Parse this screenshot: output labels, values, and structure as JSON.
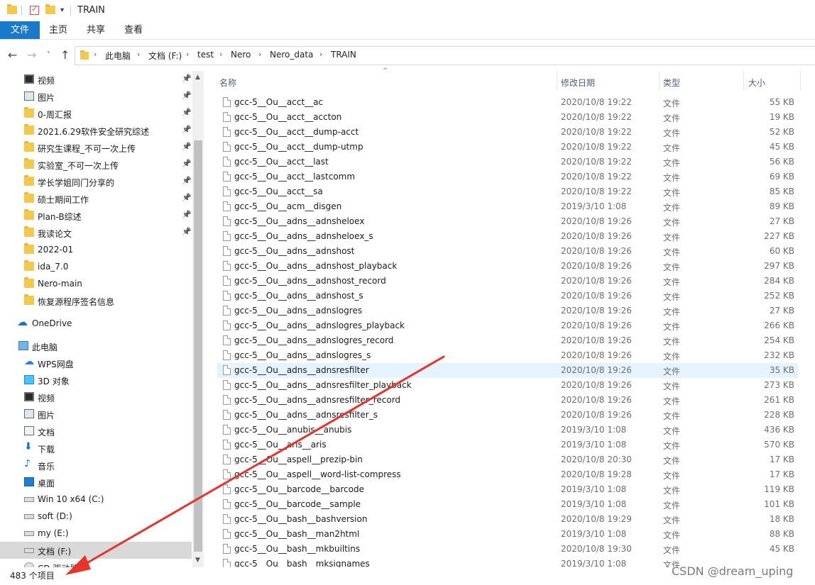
{
  "window": {
    "title": "TRAIN"
  },
  "ribbon": {
    "tabs": [
      "文件",
      "主页",
      "共享",
      "查看"
    ]
  },
  "address": {
    "crumbs": [
      "此电脑",
      "文档 (F:)",
      "test",
      "Nero",
      "Nero_data",
      "TRAIN"
    ]
  },
  "nav": {
    "quick": [
      {
        "label": "视频",
        "icon": "video-icon",
        "pinned": true
      },
      {
        "label": "图片",
        "icon": "pictures-icon",
        "pinned": true
      },
      {
        "label": "0-周汇报",
        "icon": "folder-icon",
        "pinned": true
      },
      {
        "label": "2021.6.29软件安全研究综述",
        "icon": "folder-icon",
        "pinned": true
      },
      {
        "label": "研究生课程_不可一次上传",
        "icon": "folder-icon",
        "pinned": true
      },
      {
        "label": "实验室_不可一次上传",
        "icon": "folder-icon",
        "pinned": true
      },
      {
        "label": "学长学姐同门分享的",
        "icon": "folder-icon",
        "pinned": true
      },
      {
        "label": "硕士期间工作",
        "icon": "folder-icon",
        "pinned": true
      },
      {
        "label": "Plan-B综述",
        "icon": "folder-icon",
        "pinned": true
      },
      {
        "label": "我读论文",
        "icon": "folder-icon",
        "pinned": true
      },
      {
        "label": "2022-01",
        "icon": "folder-icon",
        "pinned": false
      },
      {
        "label": "ida_7.0",
        "icon": "folder-icon",
        "pinned": false
      },
      {
        "label": "Nero-main",
        "icon": "folder-icon",
        "pinned": false
      },
      {
        "label": "恢复源程序签名信息",
        "icon": "folder-icon",
        "pinned": false
      }
    ],
    "onedrive": "OneDrive",
    "thispc": "此电脑",
    "pc_items": [
      {
        "label": "WPS网盘",
        "icon": "wps-cloud-icon"
      },
      {
        "label": "3D 对象",
        "icon": "3d-objects-icon"
      },
      {
        "label": "视频",
        "icon": "video-icon"
      },
      {
        "label": "图片",
        "icon": "pictures-icon"
      },
      {
        "label": "文档",
        "icon": "documents-icon"
      },
      {
        "label": "下载",
        "icon": "downloads-icon"
      },
      {
        "label": "音乐",
        "icon": "music-icon"
      },
      {
        "label": "桌面",
        "icon": "desktop-icon"
      },
      {
        "label": "Win 10 x64 (C:)",
        "icon": "drive-icon"
      },
      {
        "label": "soft (D:)",
        "icon": "drive-icon"
      },
      {
        "label": "my (E:)",
        "icon": "drive-icon"
      },
      {
        "label": "文档 (F:)",
        "icon": "drive-icon",
        "selected": true
      },
      {
        "label": "CD 驱动器 (",
        "icon": "cd-drive-icon"
      }
    ]
  },
  "columns": {
    "name": "名称",
    "date": "修改日期",
    "type": "类型",
    "size": "大小"
  },
  "files": [
    {
      "name": "gcc-5__Ou__acct__ac",
      "date": "2020/10/8 19:22",
      "type": "文件",
      "size": "55 KB"
    },
    {
      "name": "gcc-5__Ou__acct__accton",
      "date": "2020/10/8 19:22",
      "type": "文件",
      "size": "19 KB"
    },
    {
      "name": "gcc-5__Ou__acct__dump-acct",
      "date": "2020/10/8 19:22",
      "type": "文件",
      "size": "52 KB"
    },
    {
      "name": "gcc-5__Ou__acct__dump-utmp",
      "date": "2020/10/8 19:22",
      "type": "文件",
      "size": "45 KB"
    },
    {
      "name": "gcc-5__Ou__acct__last",
      "date": "2020/10/8 19:22",
      "type": "文件",
      "size": "56 KB"
    },
    {
      "name": "gcc-5__Ou__acct__lastcomm",
      "date": "2020/10/8 19:22",
      "type": "文件",
      "size": "69 KB"
    },
    {
      "name": "gcc-5__Ou__acct__sa",
      "date": "2020/10/8 19:22",
      "type": "文件",
      "size": "85 KB"
    },
    {
      "name": "gcc-5__Ou__acm__disgen",
      "date": "2019/3/10 1:08",
      "type": "文件",
      "size": "89 KB"
    },
    {
      "name": "gcc-5__Ou__adns__adnsheloex",
      "date": "2020/10/8 19:26",
      "type": "文件",
      "size": "27 KB"
    },
    {
      "name": "gcc-5__Ou__adns__adnsheloex_s",
      "date": "2020/10/8 19:26",
      "type": "文件",
      "size": "227 KB"
    },
    {
      "name": "gcc-5__Ou__adns__adnshost",
      "date": "2020/10/8 19:26",
      "type": "文件",
      "size": "60 KB"
    },
    {
      "name": "gcc-5__Ou__adns__adnshost_playback",
      "date": "2020/10/8 19:26",
      "type": "文件",
      "size": "297 KB"
    },
    {
      "name": "gcc-5__Ou__adns__adnshost_record",
      "date": "2020/10/8 19:26",
      "type": "文件",
      "size": "284 KB"
    },
    {
      "name": "gcc-5__Ou__adns__adnshost_s",
      "date": "2020/10/8 19:26",
      "type": "文件",
      "size": "252 KB"
    },
    {
      "name": "gcc-5__Ou__adns__adnslogres",
      "date": "2020/10/8 19:26",
      "type": "文件",
      "size": "27 KB"
    },
    {
      "name": "gcc-5__Ou__adns__adnslogres_playback",
      "date": "2020/10/8 19:26",
      "type": "文件",
      "size": "266 KB"
    },
    {
      "name": "gcc-5__Ou__adns__adnslogres_record",
      "date": "2020/10/8 19:26",
      "type": "文件",
      "size": "254 KB"
    },
    {
      "name": "gcc-5__Ou__adns__adnslogres_s",
      "date": "2020/10/8 19:26",
      "type": "文件",
      "size": "232 KB"
    },
    {
      "name": "gcc-5__Ou__adns__adnsresfilter",
      "date": "2020/10/8 19:26",
      "type": "文件",
      "size": "35 KB",
      "selected": true
    },
    {
      "name": "gcc-5__Ou__adns__adnsresfilter_playback",
      "date": "2020/10/8 19:26",
      "type": "文件",
      "size": "273 KB"
    },
    {
      "name": "gcc-5__Ou__adns__adnsresfilter_record",
      "date": "2020/10/8 19:26",
      "type": "文件",
      "size": "261 KB"
    },
    {
      "name": "gcc-5__Ou__adns__adnsresfilter_s",
      "date": "2020/10/8 19:26",
      "type": "文件",
      "size": "228 KB"
    },
    {
      "name": "gcc-5__Ou__anubis__anubis",
      "date": "2019/3/10 1:08",
      "type": "文件",
      "size": "436 KB"
    },
    {
      "name": "gcc-5__Ou__aris__aris",
      "date": "2019/3/10 1:08",
      "type": "文件",
      "size": "570 KB"
    },
    {
      "name": "gcc-5__Ou__aspell__prezip-bin",
      "date": "2020/10/8 20:30",
      "type": "文件",
      "size": "17 KB"
    },
    {
      "name": "gcc-5__Ou__aspell__word-list-compress",
      "date": "2020/10/8 19:28",
      "type": "文件",
      "size": "17 KB"
    },
    {
      "name": "gcc-5__Ou__barcode__barcode",
      "date": "2019/3/10 1:08",
      "type": "文件",
      "size": "119 KB"
    },
    {
      "name": "gcc-5__Ou__barcode__sample",
      "date": "2019/3/10 1:08",
      "type": "文件",
      "size": "101 KB"
    },
    {
      "name": "gcc-5__Ou__bash__bashversion",
      "date": "2020/10/8 19:29",
      "type": "文件",
      "size": "18 KB"
    },
    {
      "name": "gcc-5__Ou__bash__man2html",
      "date": "2019/3/10 1:08",
      "type": "文件",
      "size": "88 KB"
    },
    {
      "name": "gcc-5__Ou__bash__mkbuiltins",
      "date": "2020/10/8 19:30",
      "type": "文件",
      "size": "45 KB"
    },
    {
      "name": "gcc-5__Ou__bash__mksignames",
      "date": "2019/3/10 1:08",
      "type": "文件",
      "size": ""
    }
  ],
  "status": {
    "count": "483 个项目"
  },
  "watermark": "CSDN @dream_uping",
  "colors": {
    "accent": "#1979ca",
    "annotation": "#e8332b",
    "selection": "#e5f3ff"
  }
}
